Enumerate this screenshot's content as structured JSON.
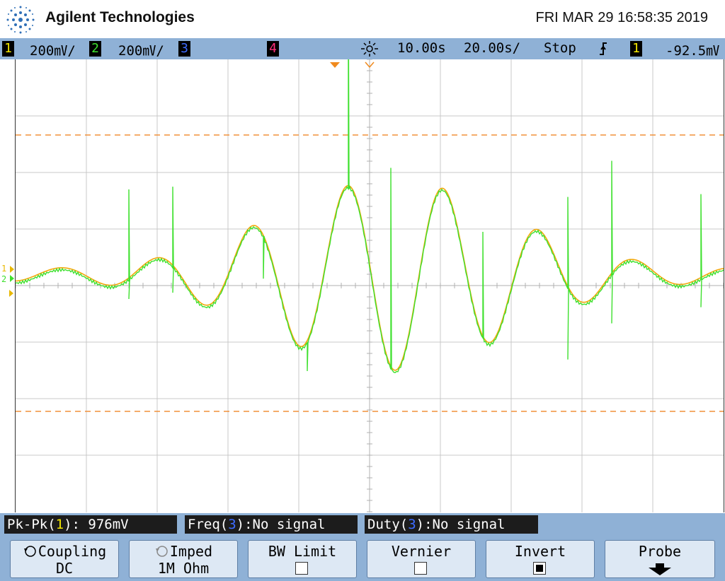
{
  "header": {
    "brand": "Agilent Technologies",
    "datetime": "FRI MAR 29 16:58:35 2019",
    "logo_icon": "agilent-spark-logo"
  },
  "status": {
    "ch1": {
      "num": "1",
      "scale": "200㎷/",
      "color": "#f2e600"
    },
    "ch2": {
      "num": "2",
      "scale": "200㎷/",
      "color": "#3ee02e"
    },
    "ch3": {
      "num": "3",
      "color": "#3d6bff"
    },
    "ch4": {
      "num": "4",
      "color": "#ff2e7a"
    },
    "delay": "10.00s",
    "timebase": "20.00s/",
    "run_state": "Stop",
    "trigger_icon": "rising-edge-icon",
    "trigger_source": "1",
    "trigger_level": "-92.5㎷"
  },
  "screen": {
    "ch1_marker": "1",
    "ch2_marker": "2",
    "trace_colors": {
      "ch1": "#f2a80a",
      "ch2": "#3ee02e",
      "cursor": "#f0903a"
    }
  },
  "measurements": {
    "m1": {
      "prefix": "Pk-Pk(",
      "ch": "1",
      "suffix": "): 976mV"
    },
    "m2": {
      "prefix": "Freq(",
      "ch": "3",
      "suffix": "):No signal"
    },
    "m3": {
      "prefix": "Duty(",
      "ch": "3",
      "suffix": "):No signal"
    }
  },
  "softkeys": {
    "coupling": {
      "label": "Coupling",
      "value": "DC"
    },
    "imped": {
      "label": "Imped",
      "value": "1M Ohm"
    },
    "bw_limit": {
      "label": "BW Limit",
      "checked": false
    },
    "vernier": {
      "label": "Vernier",
      "checked": false
    },
    "invert": {
      "label": "Invert",
      "checked": true
    },
    "probe": {
      "label": "Probe"
    }
  }
}
